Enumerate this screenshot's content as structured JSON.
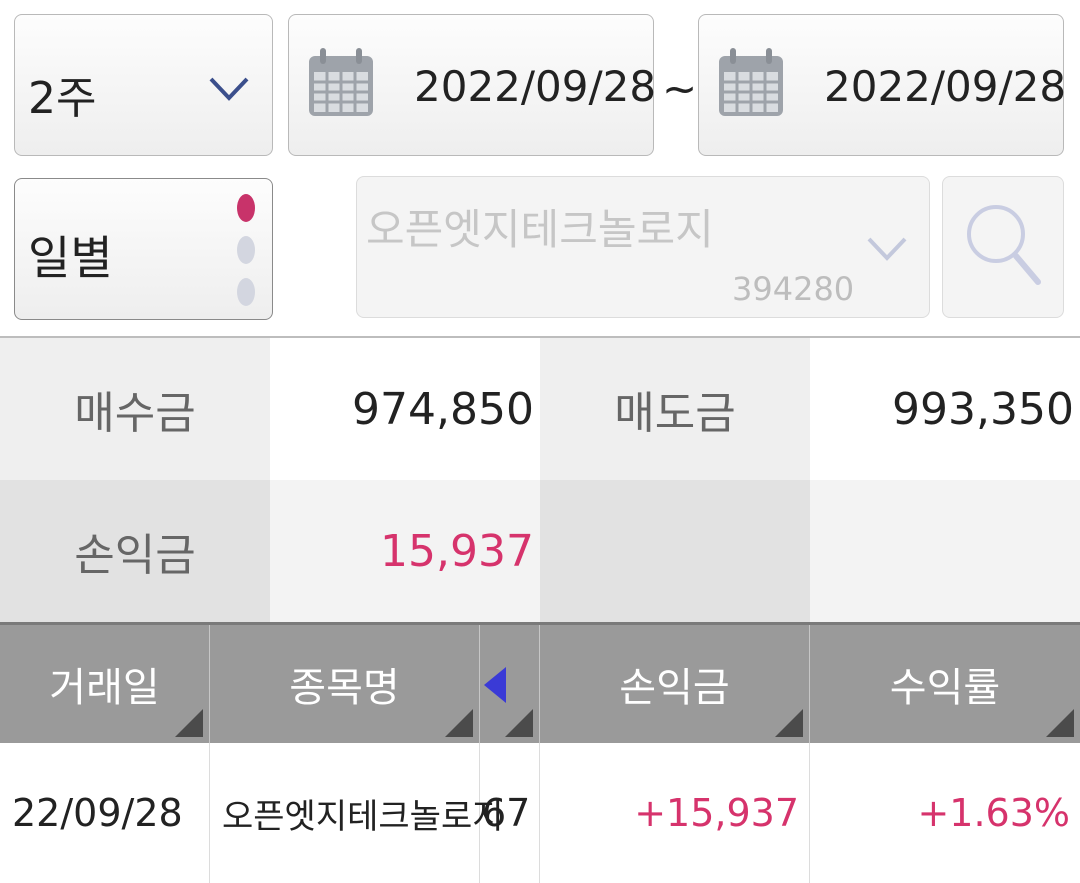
{
  "filter": {
    "period_select": {
      "value": "2주",
      "icon": "chevron-down-icon"
    },
    "start_date": {
      "value": "2022/09/28",
      "icon": "calendar-icon"
    },
    "separator": "~",
    "end_date": {
      "value": "2022/09/28",
      "icon": "calendar-icon"
    },
    "interval_toggle": {
      "value": "일별",
      "dots": [
        "active",
        "inactive",
        "inactive"
      ]
    },
    "stock_select": {
      "name": "오픈엣지테크놀로지",
      "code": "394280",
      "icon": "chevron-down-icon"
    },
    "search_button": {
      "icon": "search-icon"
    }
  },
  "summary": {
    "buy_label": "매수금",
    "buy_value": "974,850",
    "sell_label": "매도금",
    "sell_value": "993,350",
    "pnl_label": "손익금",
    "pnl_value": "15,937"
  },
  "table": {
    "headers": [
      "거래일",
      "종목명",
      "손익금",
      "수익률"
    ],
    "rows": [
      {
        "date": "22/09/28",
        "name": "오픈엣지테크놀로지",
        "qty": "67",
        "pnl": "+15,937",
        "rate": "+1.63%"
      }
    ]
  },
  "colors": {
    "accent_pink": "#d6336c",
    "header_gray": "#9a9a9a",
    "scroll_arrow": "#3a3ad6"
  }
}
